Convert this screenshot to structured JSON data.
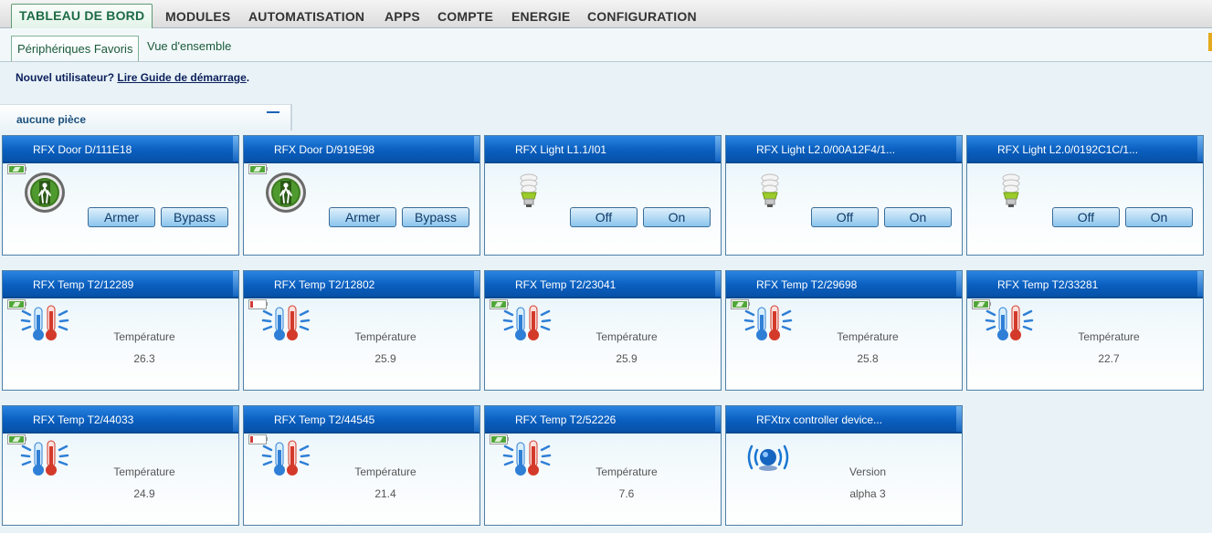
{
  "menu": {
    "items": [
      "TABLEAU DE BORD",
      "MODULES",
      "AUTOMATISATION",
      "APPS",
      "COMPTE",
      "ENERGIE",
      "CONFIGURATION"
    ]
  },
  "subtabs": {
    "active": "Périphériques Favoris",
    "other": "Vue d'ensemble"
  },
  "notice": {
    "prefix": "Nouvel utilisateur?",
    "link": "Lire Guide de démarrage",
    "suffix": "."
  },
  "room": {
    "name": "aucune pièce"
  },
  "devices": [
    {
      "name": "RFX Door D/111E18",
      "icon": "door-sensor-icon",
      "battery": "ok",
      "buttons": [
        "Armer",
        "Bypass"
      ]
    },
    {
      "name": "RFX Door D/919E98",
      "icon": "door-sensor-icon",
      "battery": "ok",
      "buttons": [
        "Armer",
        "Bypass"
      ]
    },
    {
      "name": "RFX Light L1.1/I01",
      "icon": "light-bulb-icon",
      "buttons": [
        "Off",
        "On"
      ]
    },
    {
      "name": "RFX Light L2.0/00A12F4/1...",
      "icon": "light-bulb-icon",
      "buttons": [
        "Off",
        "On"
      ]
    },
    {
      "name": "RFX Light L2.0/0192C1C/1...",
      "icon": "light-bulb-icon",
      "buttons": [
        "Off",
        "On"
      ]
    },
    {
      "name": "RFX Temp T2/12289",
      "icon": "thermometer-icon",
      "battery": "ok",
      "label": "Température",
      "value": "26.3"
    },
    {
      "name": "RFX Temp T2/12802",
      "icon": "thermometer-icon",
      "battery": "low",
      "label": "Température",
      "value": "25.9"
    },
    {
      "name": "RFX Temp T2/23041",
      "icon": "thermometer-icon",
      "battery": "ok",
      "label": "Température",
      "value": "25.9"
    },
    {
      "name": "RFX Temp T2/29698",
      "icon": "thermometer-icon",
      "battery": "ok",
      "label": "Température",
      "value": "25.8"
    },
    {
      "name": "RFX Temp T2/33281",
      "icon": "thermometer-icon",
      "battery": "ok",
      "label": "Température",
      "value": "22.7"
    },
    {
      "name": "RFX Temp T2/44033",
      "icon": "thermometer-icon",
      "battery": "ok",
      "label": "Température",
      "value": "24.9"
    },
    {
      "name": "RFX Temp T2/44545",
      "icon": "thermometer-icon",
      "battery": "low",
      "label": "Température",
      "value": "21.4"
    },
    {
      "name": "RFX Temp T2/52226",
      "icon": "thermometer-icon",
      "battery": "ok",
      "label": "Température",
      "value": "7.6"
    },
    {
      "name": "RFXtrx controller device...",
      "icon": "wireless-controller-icon",
      "label": "Version",
      "value": "alpha 3"
    }
  ],
  "colors": {
    "tile_header": "#0a5fbf",
    "active_menu": "#1d6b45",
    "battery_ok": "#51a63a",
    "battery_low": "#d13a3a"
  }
}
